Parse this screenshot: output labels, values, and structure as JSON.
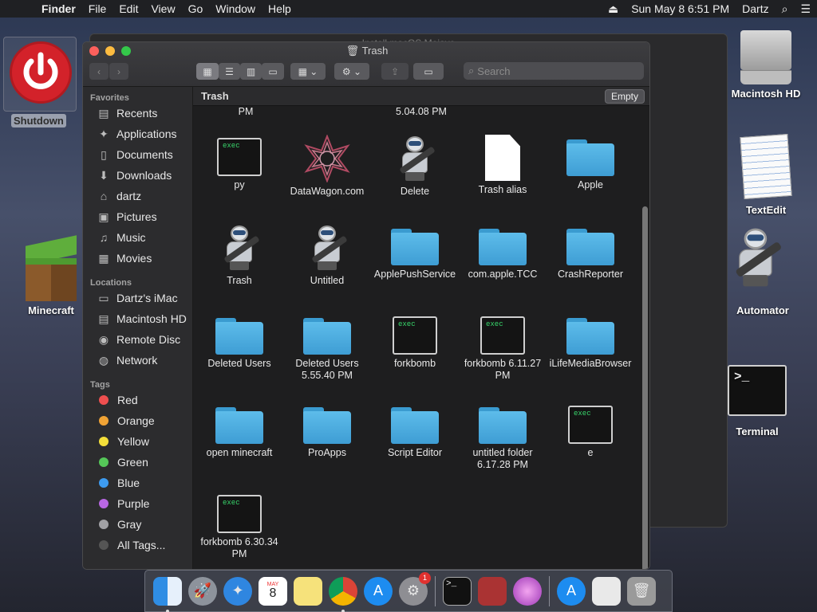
{
  "menubar": {
    "app": "Finder",
    "items": [
      "File",
      "Edit",
      "View",
      "Go",
      "Window",
      "Help"
    ],
    "clock": "Sun May 8  6:51 PM",
    "user": "Dartz"
  },
  "desktop": {
    "shutdown": "Shutdown",
    "minecraft": "Minecraft",
    "macintosh_hd": "Macintosh HD",
    "textedit": "TextEdit",
    "automator": "Automator",
    "terminal": "Terminal",
    "terminal_prompt": ">_"
  },
  "back_window": {
    "title": "Install macOS Mojave"
  },
  "window": {
    "title": "Trash",
    "search_placeholder": "Search",
    "path": "Trash",
    "empty_button": "Empty"
  },
  "sidebar": {
    "favorites_header": "Favorites",
    "favorites": [
      "Recents",
      "Applications",
      "Documents",
      "Downloads",
      "dartz",
      "Pictures",
      "Music",
      "Movies"
    ],
    "locations_header": "Locations",
    "locations": [
      "Dartz's iMac",
      "Macintosh HD",
      "Remote Disc",
      "Network"
    ],
    "tags_header": "Tags",
    "tags": [
      {
        "label": "Red",
        "color": "#ef4f4f"
      },
      {
        "label": "Orange",
        "color": "#f0a335"
      },
      {
        "label": "Yellow",
        "color": "#f4df3a"
      },
      {
        "label": "Green",
        "color": "#55c758"
      },
      {
        "label": "Blue",
        "color": "#3d9bf0"
      },
      {
        "label": "Purple",
        "color": "#b967e3"
      },
      {
        "label": "Gray",
        "color": "#a1a1a5"
      }
    ],
    "all_tags": "All Tags..."
  },
  "files": {
    "top_partial": [
      "PM",
      "5.04.08 PM"
    ],
    "items": [
      {
        "name": "py",
        "kind": "exec"
      },
      {
        "name": "DataWagon.com",
        "kind": "star"
      },
      {
        "name": "Delete",
        "kind": "robot"
      },
      {
        "name": "Trash alias",
        "kind": "doc"
      },
      {
        "name": "Apple",
        "kind": "folder"
      },
      {
        "name": "Trash",
        "kind": "robot"
      },
      {
        "name": "Untitled",
        "kind": "robot"
      },
      {
        "name": "ApplePushService",
        "kind": "folder"
      },
      {
        "name": "com.apple.TCC",
        "kind": "folder"
      },
      {
        "name": "CrashReporter",
        "kind": "folder"
      },
      {
        "name": "Deleted Users",
        "kind": "folder"
      },
      {
        "name": "Deleted Users 5.55.40 PM",
        "kind": "folder"
      },
      {
        "name": "forkbomb",
        "kind": "exec"
      },
      {
        "name": "forkbomb 6.11.27 PM",
        "kind": "exec"
      },
      {
        "name": "iLifeMediaBrowser",
        "kind": "folder"
      },
      {
        "name": "open minecraft",
        "kind": "folder"
      },
      {
        "name": "ProApps",
        "kind": "folder"
      },
      {
        "name": "Script Editor",
        "kind": "folder"
      },
      {
        "name": "untitled folder 6.17.28 PM",
        "kind": "folder"
      },
      {
        "name": "e",
        "kind": "exec"
      },
      {
        "name": "forkbomb 6.30.34 PM",
        "kind": "exec"
      }
    ],
    "exec_text": "exec"
  },
  "dock": {
    "calendar_month": "MAY",
    "calendar_day": "8",
    "badge": "1"
  }
}
